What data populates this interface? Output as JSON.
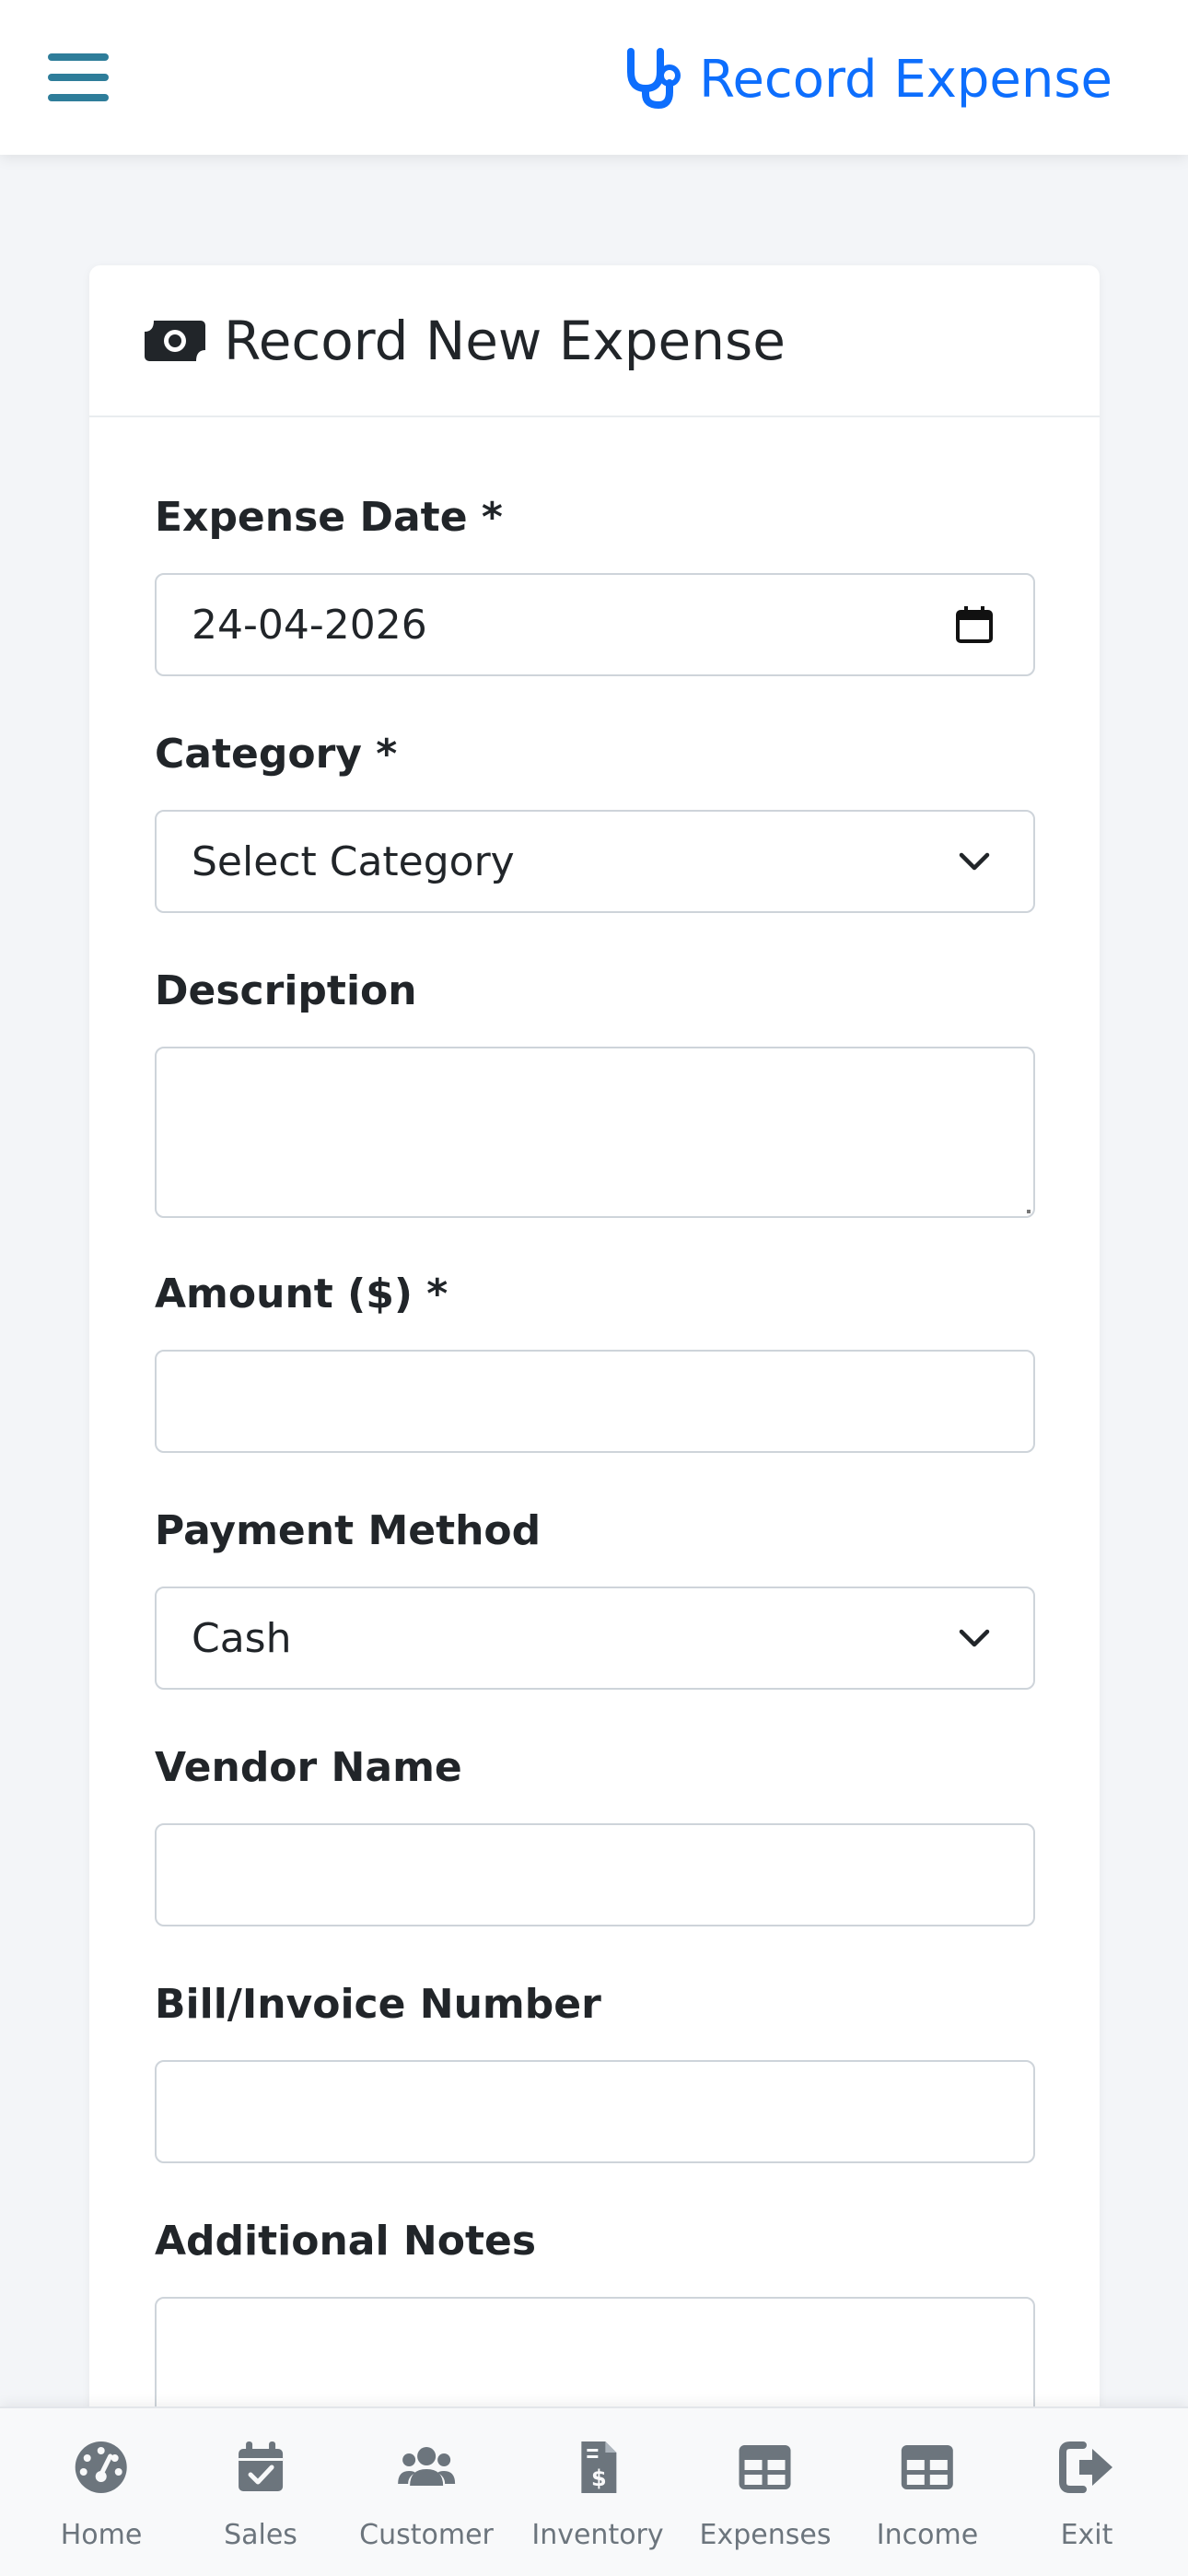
{
  "header": {
    "menu_icon": "hamburger-menu-icon",
    "brand_icon": "stethoscope-icon",
    "brand_title": "Record Expense",
    "accent_color": "#0d6efd"
  },
  "card": {
    "icon": "money-bill-icon",
    "title": "Record New Expense"
  },
  "form": {
    "expense_date": {
      "label": "Expense Date *",
      "value": "24-04-2026",
      "icon": "calendar-icon"
    },
    "category": {
      "label": "Category *",
      "selected": "Select Category",
      "icon": "chevron-down-icon"
    },
    "description": {
      "label": "Description",
      "value": ""
    },
    "amount": {
      "label": "Amount ($) *",
      "value": ""
    },
    "payment_method": {
      "label": "Payment Method",
      "selected": "Cash",
      "icon": "chevron-down-icon"
    },
    "vendor_name": {
      "label": "Vendor Name",
      "value": ""
    },
    "bill_number": {
      "label": "Bill/Invoice Number",
      "value": ""
    },
    "notes": {
      "label": "Additional Notes",
      "value": ""
    }
  },
  "bottom_nav": {
    "items": [
      {
        "label": "Home",
        "icon": "dashboard-gauge-icon"
      },
      {
        "label": "Sales",
        "icon": "calendar-check-icon"
      },
      {
        "label": "Customer",
        "icon": "users-icon"
      },
      {
        "label": "Inventory",
        "icon": "invoice-dollar-icon"
      },
      {
        "label": "Expenses",
        "icon": "table-icon"
      },
      {
        "label": "Income",
        "icon": "table-icon"
      },
      {
        "label": "Exit",
        "icon": "sign-out-icon"
      }
    ]
  }
}
